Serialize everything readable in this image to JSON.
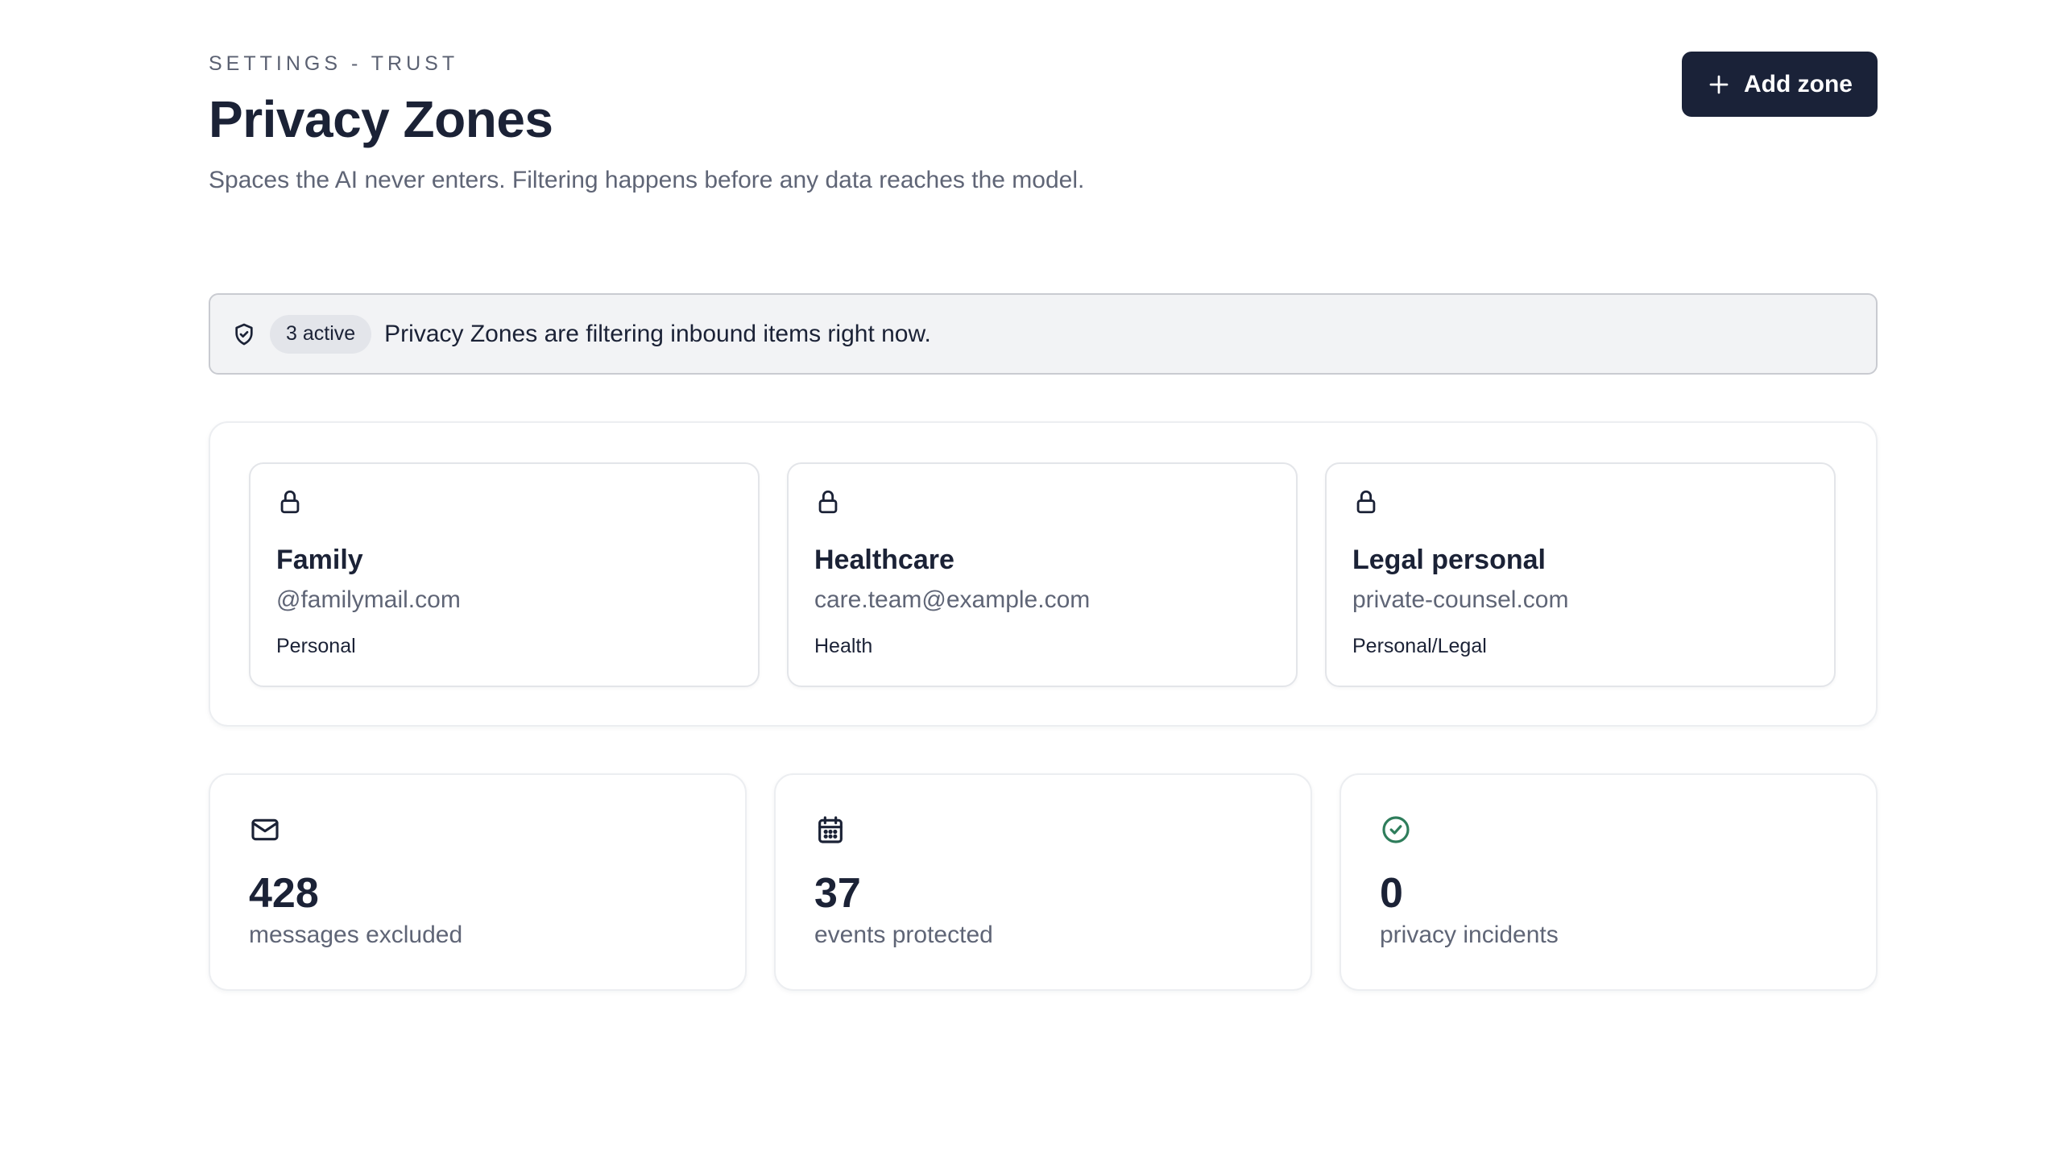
{
  "header": {
    "eyebrow": "SETTINGS - TRUST",
    "title": "Privacy Zones",
    "subtitle": "Spaces the AI never enters. Filtering happens before any data reaches the model.",
    "add_button_label": "Add zone",
    "add_button_icon": "plus-icon"
  },
  "banner": {
    "icon": "shield-check-icon",
    "badge": "3 active",
    "text": "Privacy Zones are filtering inbound items right now."
  },
  "zones": [
    {
      "icon": "lock-icon",
      "name": "Family",
      "address": "@familymail.com",
      "category": "Personal"
    },
    {
      "icon": "lock-icon",
      "name": "Healthcare",
      "address": "care.team@example.com",
      "category": "Health"
    },
    {
      "icon": "lock-icon",
      "name": "Legal personal",
      "address": "private-counsel.com",
      "category": "Personal/Legal"
    }
  ],
  "stats": [
    {
      "icon": "mail-icon",
      "value": "428",
      "label": "messages excluded"
    },
    {
      "icon": "calendar-icon",
      "value": "37",
      "label": "events protected"
    },
    {
      "icon": "check-circle-icon",
      "value": "0",
      "label": "privacy incidents"
    }
  ],
  "colors": {
    "primary_button": "#1a2238",
    "banner_bg": "#f2f3f5",
    "success_icon": "#2e7d5b",
    "muted_text": "#5f6576"
  }
}
